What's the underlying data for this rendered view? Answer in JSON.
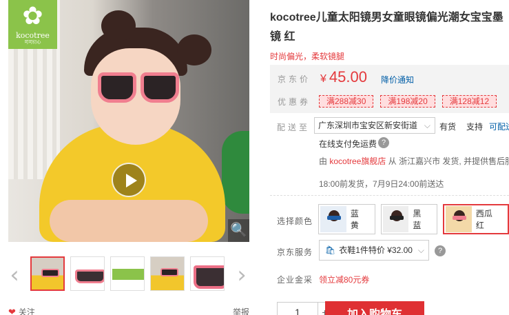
{
  "gallery": {
    "logo_name": "kocotree",
    "logo_sub": "可可衍心",
    "prev_glyph": "‹",
    "next_glyph": "›",
    "zoom_glyph": "🔍",
    "follow_label": "关注",
    "report_label": "举报"
  },
  "product": {
    "title": "kocotree儿童太阳镜男女童眼镜偏光潮女宝宝墨镜 红",
    "subtitle": "时尚偏光，柔软镜腿"
  },
  "price": {
    "label": "京东价",
    "currency": "¥",
    "value": "45.00",
    "notify": "降价通知"
  },
  "promo": {
    "label": "优惠券",
    "coupons": [
      "满288减30",
      "满198减20",
      "满128减12"
    ]
  },
  "delivery": {
    "label": "配送至",
    "address": "广东深圳市宝安区新安街道",
    "stock": "有货",
    "support": "支持",
    "support_more": "可配送",
    "free_ship": "在线支付免运费",
    "seller_prefix": "由",
    "seller_shop": "kocotree旗舰店",
    "seller_suffix": "从 浙江嘉兴市 发货, 并提供售后服务",
    "ship_time": "18:00前发货，7月9日24:00前送达"
  },
  "color": {
    "label": "选择颜色",
    "options": [
      {
        "name": "蓝黄",
        "selected": false
      },
      {
        "name": "黑蓝",
        "selected": false
      },
      {
        "name": "西瓜红",
        "selected": true
      }
    ]
  },
  "service": {
    "label": "京东服务",
    "value": "衣鞋1件特价 ¥32.00"
  },
  "finance": {
    "label": "企业金采",
    "value": "领立减80元券"
  },
  "purchase": {
    "quantity": "1",
    "plus": "+",
    "add_to_cart": "加入购物车"
  },
  "colors": {
    "accent": "#e4393c",
    "link": "#005ea7",
    "logo_green": "#8bc34a"
  }
}
